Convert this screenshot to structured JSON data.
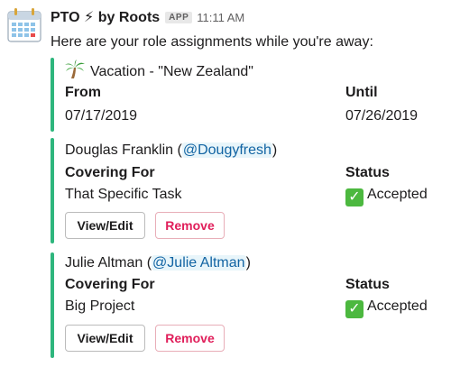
{
  "message": {
    "bot_name": "PTO ⚡ by Roots",
    "badge": "APP",
    "time": "11:11 AM",
    "intro": "Here are your role assignments while you're away:"
  },
  "vacation": {
    "icon": "palm-tree-icon",
    "title": "Vacation - \"New Zealand\"",
    "from_label": "From",
    "from_value": "07/17/2019",
    "until_label": "Until",
    "until_value": "07/26/2019"
  },
  "assignments": [
    {
      "name": "Douglas Franklin",
      "handle": "@Dougyfresh",
      "covering_label": "Covering For",
      "covering_value": "That Specific Task",
      "status_label": "Status",
      "status_value": "Accepted",
      "edit_label": "View/Edit",
      "remove_label": "Remove"
    },
    {
      "name": "Julie Altman",
      "handle": "@Julie Altman",
      "covering_label": "Covering For",
      "covering_value": "Big Project",
      "status_label": "Status",
      "status_value": "Accepted",
      "edit_label": "View/Edit",
      "remove_label": "Remove"
    }
  ],
  "colors": {
    "accent_bar": "#2eb67d",
    "mention": "#1264a3",
    "remove": "#e01e5a",
    "accepted_check": "#4cb83f"
  }
}
